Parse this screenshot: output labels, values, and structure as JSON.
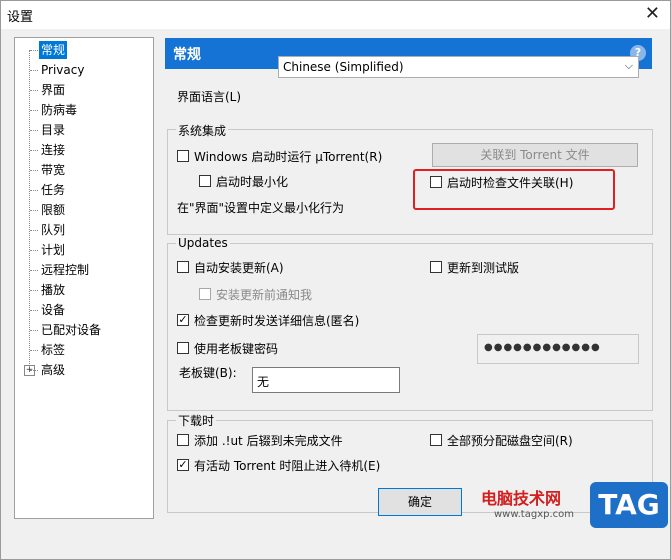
{
  "window": {
    "title": "设置",
    "close_glyph": "✕"
  },
  "sidebar": {
    "items": [
      {
        "label": "常规",
        "selected": true
      },
      {
        "label": "Privacy"
      },
      {
        "label": "界面"
      },
      {
        "label": "防病毒"
      },
      {
        "label": "目录"
      },
      {
        "label": "连接"
      },
      {
        "label": "带宽"
      },
      {
        "label": "任务"
      },
      {
        "label": "限额"
      },
      {
        "label": "队列"
      },
      {
        "label": "计划"
      },
      {
        "label": "远程控制"
      },
      {
        "label": "播放"
      },
      {
        "label": "设备"
      },
      {
        "label": "已配对设备"
      },
      {
        "label": "标签"
      },
      {
        "label": "高级",
        "expandable": true
      }
    ],
    "expander_glyph": "+"
  },
  "header": {
    "title": "常规",
    "help_glyph": "?"
  },
  "language": {
    "label": "界面语言(L)",
    "value": "Chinese (Simplified)",
    "arrow_glyph": "⌵"
  },
  "system_integration": {
    "title": "系统集成",
    "run_on_startup": {
      "label": "Windows 启动时运行 µTorrent(R)",
      "checked": false
    },
    "start_minimized": {
      "label": "启动时最小化",
      "checked": false
    },
    "associate_button": "关联到 Torrent 文件",
    "check_association": {
      "label": "启动时检查文件关联(H)",
      "checked": false
    },
    "note": "在\"界面\"设置中定义最小化行为"
  },
  "updates": {
    "title": "Updates",
    "auto_install": {
      "label": "自动安装更新(A)",
      "checked": false
    },
    "beta": {
      "label": "更新到测试版",
      "checked": false
    },
    "notify_before": {
      "label": "安装更新前通知我",
      "checked": false
    },
    "send_info": {
      "label": "检查更新时发送详细信息(匿名)",
      "checked": true
    },
    "boss_key_password": {
      "label": "使用老板键密码",
      "checked": false
    },
    "password_value": "●●●●●●●●●●●●",
    "boss_key_label": "老板键(B):",
    "boss_key_value": "无"
  },
  "downloading": {
    "title": "下载时",
    "append_ut": {
      "label": "添加 .!ut 后辍到未完成文件",
      "checked": false
    },
    "prealloc": {
      "label": "全部预分配磁盘空间(R)",
      "checked": false
    },
    "prevent_standby": {
      "label": "有活动 Torrent 时阻止进入待机(E)",
      "checked": true
    }
  },
  "footer": {
    "ok": "确定"
  },
  "check_glyph": "✓",
  "watermark": {
    "text": "电脑技术网",
    "url": "www.tagxp.com",
    "logo": "TAG"
  }
}
